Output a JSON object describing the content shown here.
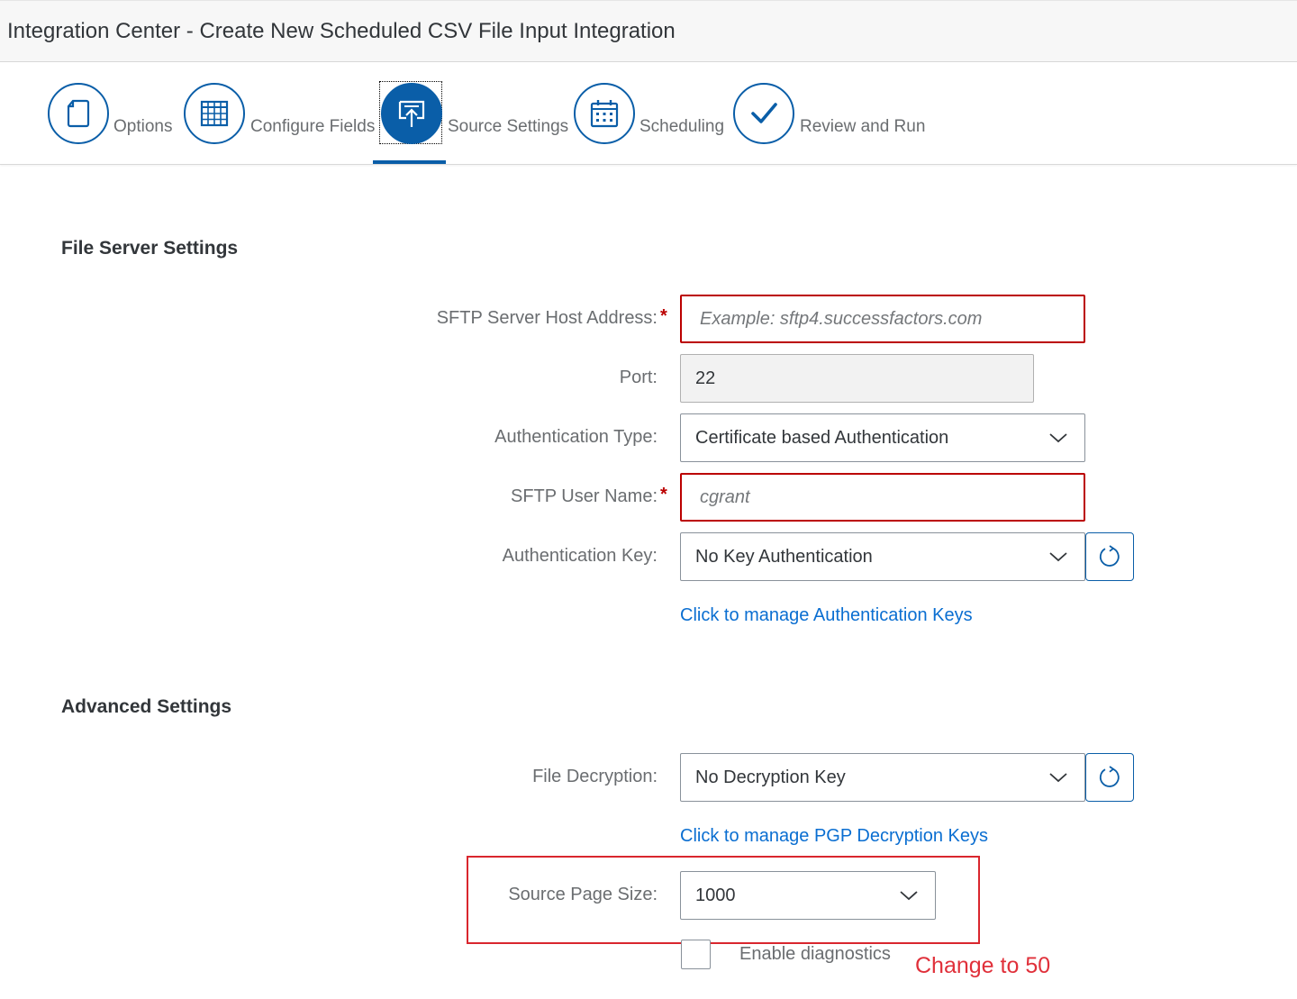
{
  "window": {
    "title": "Integration Center - Create New Scheduled CSV File Input Integration"
  },
  "wizard": {
    "steps": [
      {
        "label": "Options",
        "icon": "document-icon",
        "active": false
      },
      {
        "label": "Configure Fields",
        "icon": "table-grid-icon",
        "active": false
      },
      {
        "label": "Source Settings",
        "icon": "upload-screen-icon",
        "active": true
      },
      {
        "label": "Scheduling",
        "icon": "calendar-icon",
        "active": false
      },
      {
        "label": "Review and Run",
        "icon": "checkmark-icon",
        "active": false
      }
    ]
  },
  "file_server": {
    "title": "File Server Settings",
    "host": {
      "label": "SFTP Server Host Address:",
      "placeholder": "Example: sftp4.successfactors.com",
      "value": "",
      "required": "*"
    },
    "port": {
      "label": "Port:",
      "value": "22"
    },
    "auth_type": {
      "label": "Authentication Type:",
      "value": "Certificate based Authentication"
    },
    "user": {
      "label": "SFTP User Name:",
      "placeholder": "cgrant",
      "value": "",
      "required": "*"
    },
    "auth_key": {
      "label": "Authentication Key:",
      "value": "No Key Authentication"
    },
    "manage_keys_link": "Click to manage Authentication Keys"
  },
  "advanced": {
    "title": "Advanced Settings",
    "decryption": {
      "label": "File Decryption:",
      "value": "No Decryption Key"
    },
    "manage_pgp_link": "Click to manage PGP Decryption Keys",
    "page_size": {
      "label": "Source Page Size:",
      "value": "1000"
    },
    "diagnostics": {
      "label": "Enable diagnostics",
      "checked": false
    }
  },
  "annotation": {
    "text": "Change to 50",
    "color": "#e0303a"
  },
  "colors": {
    "accent": "#0a5ea8",
    "link": "#0a6ed1",
    "error": "#bb0000"
  }
}
